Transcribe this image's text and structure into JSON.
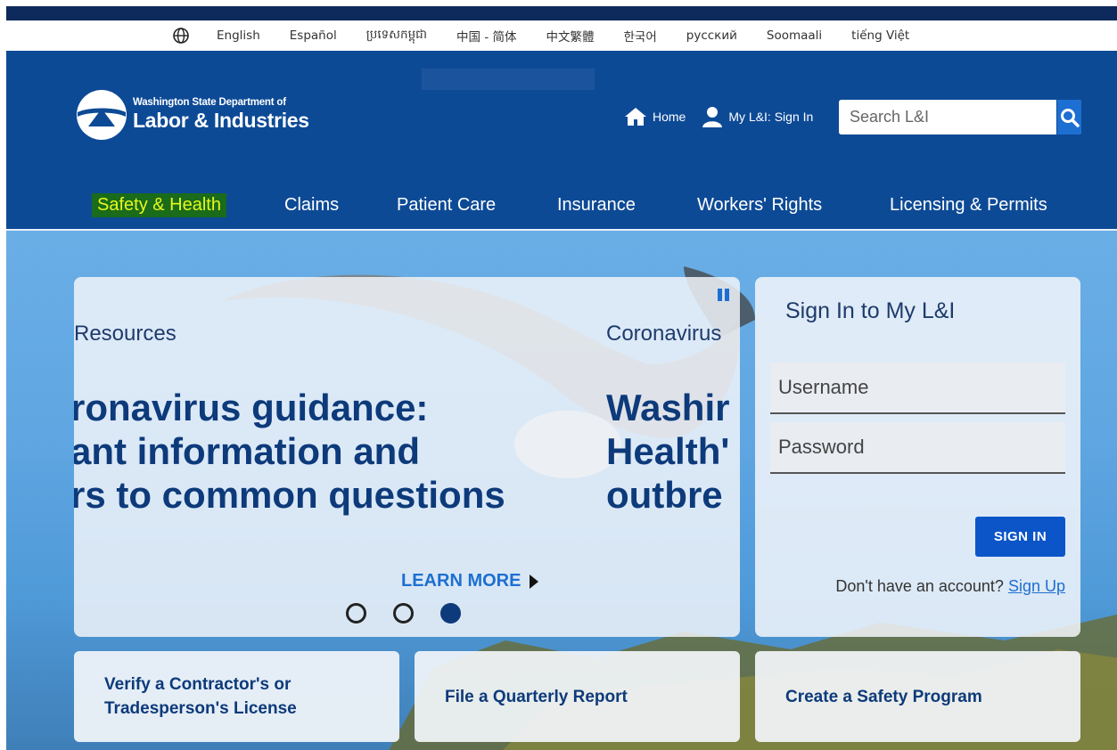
{
  "languages": [
    "English",
    "Español",
    "ប្រទេសកម្ពុជា",
    "中国 - 简体",
    "中文繁體",
    "한국어",
    "русский",
    "Soomaali",
    "tiếng Việt"
  ],
  "logo": {
    "line1": "Washington State Department of",
    "line2": "Labor & Industries"
  },
  "utility": {
    "home": "Home",
    "signin": "My L&I: Sign In"
  },
  "search": {
    "placeholder": "Search L&I"
  },
  "nav": [
    "Safety & Health",
    "Claims",
    "Patient Care",
    "Insurance",
    "Workers' Rights",
    "Licensing & Permits"
  ],
  "slides": {
    "left": {
      "kicker": "Resources",
      "l1": "ronavirus guidance:",
      "l2": "ant information and",
      "l3": "rs to common questions"
    },
    "right": {
      "kicker": "Coronavirus",
      "l1": "Washir",
      "l2": "Health'",
      "l3": "outbre"
    },
    "learn_more": "LEARN MORE",
    "dot_count": 3,
    "active_dot": 3
  },
  "signin": {
    "title": "Sign In to My L&I",
    "username_placeholder": "Username",
    "password_placeholder": "Password",
    "button": "SIGN IN",
    "no_account": "Don't have an account?",
    "signup": "Sign Up"
  },
  "tiles": [
    {
      "l1": "Verify a Contractor's or",
      "l2": "Tradesperson's License"
    },
    {
      "l1": "File a Quarterly Report"
    },
    {
      "l1": "Create a Safety Program"
    }
  ],
  "colors": {
    "header": "#0d4a96",
    "accent": "#1d6fd1",
    "highlight_bg": "#1a6b1a",
    "highlight_text": "#e6f91a"
  }
}
